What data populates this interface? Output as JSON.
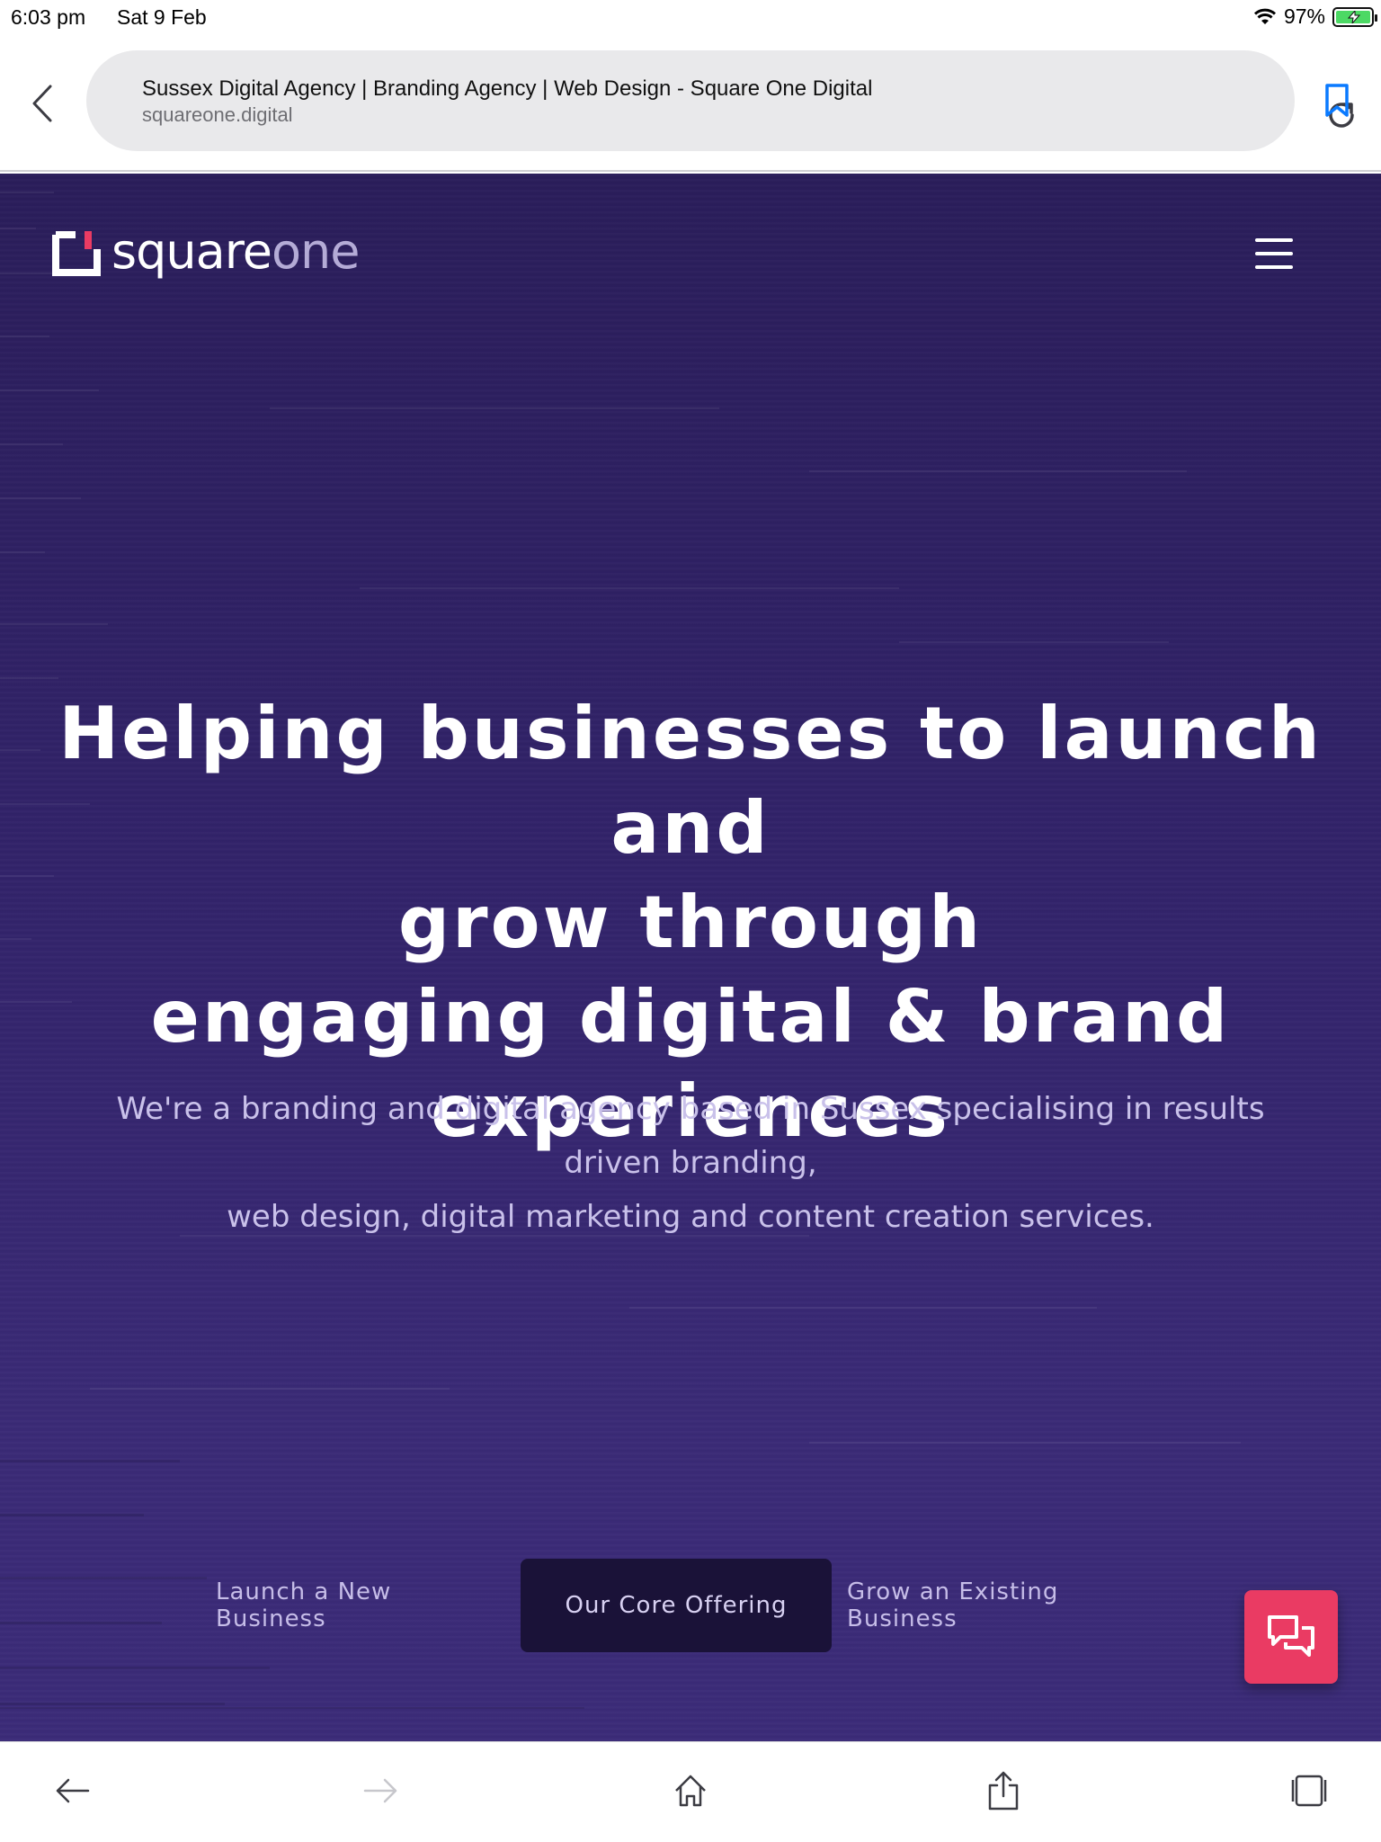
{
  "status_bar": {
    "time": "6:03 pm",
    "date": "Sat 9 Feb",
    "battery": "97%",
    "icons": [
      "wifi-icon",
      "battery-charging-icon"
    ]
  },
  "browser": {
    "page_title": "Sussex Digital Agency | Branding Agency | Web Design - Square One Digital",
    "host": "squareone.digital",
    "icons": [
      "back-chevron-icon",
      "reload-icon",
      "bookmark-icon"
    ]
  },
  "site": {
    "logo": {
      "word_a": "square",
      "word_b": "one"
    },
    "headline_lines": [
      "Helping businesses to launch and",
      "grow through",
      "engaging digital & brand",
      "experiences"
    ],
    "subline_lines": [
      "We're a branding and digital agency based in Sussex specialising in results",
      "driven branding,",
      "web design, digital marketing and content creation services."
    ],
    "tabs": [
      {
        "label": "Launch a New Business",
        "active": false
      },
      {
        "label": "Our Core Offering",
        "active": true
      },
      {
        "label": "Grow an Existing Business",
        "active": false
      }
    ],
    "colors": {
      "background": "#32236a",
      "accent": "#ea3b63",
      "active_tab": "#1a1238"
    }
  },
  "toolbar": {
    "icons": [
      "back-arrow-icon",
      "forward-arrow-icon",
      "home-icon",
      "share-icon",
      "tabs-icon"
    ]
  }
}
